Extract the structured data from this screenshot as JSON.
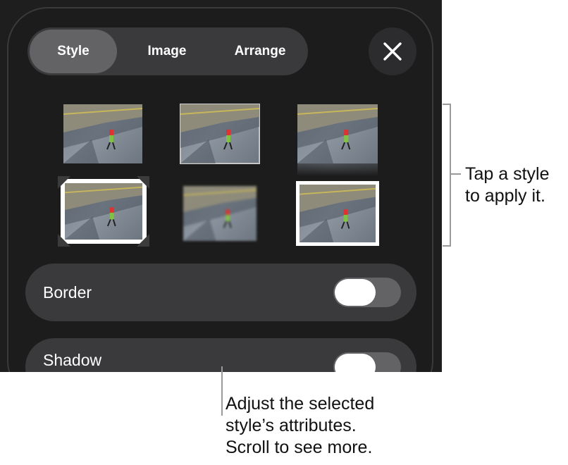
{
  "tabs": [
    {
      "label": "Style",
      "active": true
    },
    {
      "label": "Image",
      "active": false
    },
    {
      "label": "Arrange",
      "active": false
    }
  ],
  "close_icon": "close-icon",
  "style_presets": [
    {
      "name": "plain"
    },
    {
      "name": "thin-border"
    },
    {
      "name": "reflection"
    },
    {
      "name": "photo-corners"
    },
    {
      "name": "soft-edges"
    },
    {
      "name": "white-frame"
    }
  ],
  "rows": {
    "border": {
      "label": "Border",
      "toggle_on": false
    },
    "shadow": {
      "label": "Shadow",
      "toggle_on": false
    }
  },
  "annotations": {
    "right": [
      "Tap a style",
      "to apply it."
    ],
    "bottom": [
      "Adjust the selected",
      "style’s attributes.",
      "Scroll to see more."
    ]
  },
  "colors": {
    "panel": "#1c1c1c",
    "control": "#3a3a3c",
    "active_segment": "#636366",
    "annotation_line": "#9a9a9a"
  }
}
